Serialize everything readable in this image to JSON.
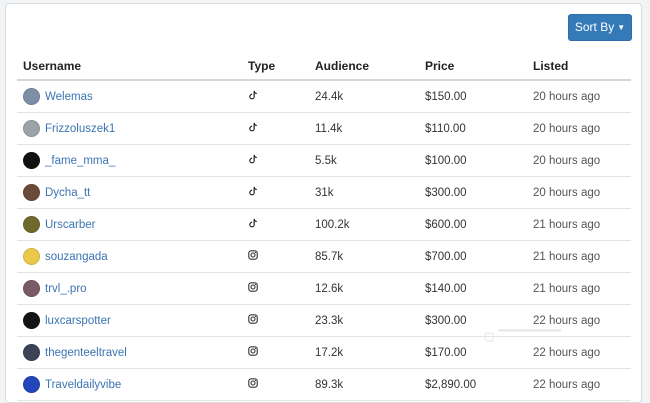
{
  "sort_button": {
    "label": "Sort By"
  },
  "columns": [
    "Username",
    "Type",
    "Audience",
    "Price",
    "Listed"
  ],
  "rows": [
    {
      "username": "Welemas",
      "type": "tiktok",
      "audience": "24.4k",
      "price": "$150.00",
      "listed": "20 hours ago",
      "avatar_color": "#7c8fa6"
    },
    {
      "username": "Frizzoluszek1",
      "type": "tiktok",
      "audience": "11.4k",
      "price": "$110.00",
      "listed": "20 hours ago",
      "avatar_color": "#9aa4a8"
    },
    {
      "username": "_fame_mma_",
      "type": "tiktok",
      "audience": "5.5k",
      "price": "$100.00",
      "listed": "20 hours ago",
      "avatar_color": "#111111"
    },
    {
      "username": "Dycha_tt",
      "type": "tiktok",
      "audience": "31k",
      "price": "$300.00",
      "listed": "20 hours ago",
      "avatar_color": "#6b4a3a"
    },
    {
      "username": "Urscarber",
      "type": "tiktok",
      "audience": "100.2k",
      "price": "$600.00",
      "listed": "21 hours ago",
      "avatar_color": "#6e6a2c"
    },
    {
      "username": "souzangada",
      "type": "instagram",
      "audience": "85.7k",
      "price": "$700.00",
      "listed": "21 hours ago",
      "avatar_color": "#e9c84a"
    },
    {
      "username": "trvl_.pro",
      "type": "instagram",
      "audience": "12.6k",
      "price": "$140.00",
      "listed": "21 hours ago",
      "avatar_color": "#7a5a66"
    },
    {
      "username": "luxcarspotter",
      "type": "instagram",
      "audience": "23.3k",
      "price": "$300.00",
      "listed": "22 hours ago",
      "avatar_color": "#141414"
    },
    {
      "username": "thegenteeltravel",
      "type": "instagram",
      "audience": "17.2k",
      "price": "$170.00",
      "listed": "22 hours ago",
      "avatar_color": "#3a4456"
    },
    {
      "username": "Traveldailyvibe",
      "type": "instagram",
      "audience": "89.3k",
      "price": "$2,890.00",
      "listed": "22 hours ago",
      "avatar_color": "#2346b8"
    }
  ],
  "colors": {
    "accent": "#3479b8",
    "link": "#3b74b2"
  }
}
